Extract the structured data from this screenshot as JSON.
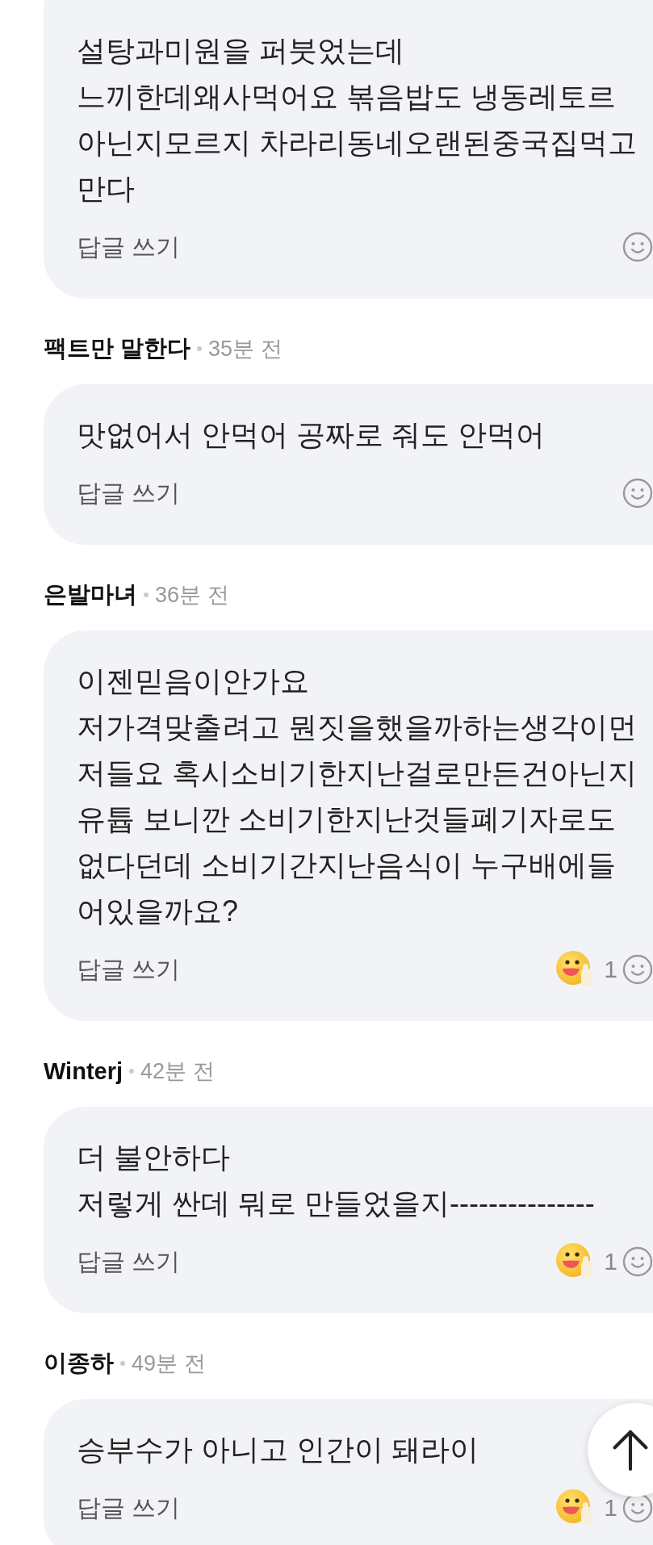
{
  "comments": [
    {
      "lines": [
        "설탕과미원을 퍼붓었는데",
        "느끼한데왜사먹어요 볶음밥도 냉동레토르",
        "아닌지모르지 차라리동네오랜된중국집먹고",
        "만다"
      ],
      "reply_label": "답글 쓰기"
    },
    {
      "author": "팩트만 말한다",
      "time": "35분 전",
      "lines": [
        "맛없어서 안먹어 공짜로 줘도 안먹어"
      ],
      "reply_label": "답글 쓰기"
    },
    {
      "author": "은발마녀",
      "time": "36분 전",
      "lines": [
        "이젠믿음이안가요",
        "저가격맞출려고 뭔짓을했을까하는생각이먼",
        "저들요 혹시소비기한지난걸로만든건아닌지",
        "유튭 보니깐 소비기한지난것들폐기자로도",
        "없다던데 소비기간지난음식이 누구배에들",
        "어있을까요?"
      ],
      "reply_label": "답글 쓰기",
      "reaction_count": "1"
    },
    {
      "author": "Winterj",
      "time": "42분 전",
      "lines": [
        "더 불안하다",
        "저렇게 싼데 뭐로 만들었을지---------------"
      ],
      "reply_label": "답글 쓰기",
      "reaction_count": "1"
    },
    {
      "author": "이종하",
      "time": "49분 전",
      "lines": [
        "승부수가 아니고 인간이 돼라이"
      ],
      "reply_label": "답글 쓰기",
      "reaction_count": "1"
    }
  ]
}
